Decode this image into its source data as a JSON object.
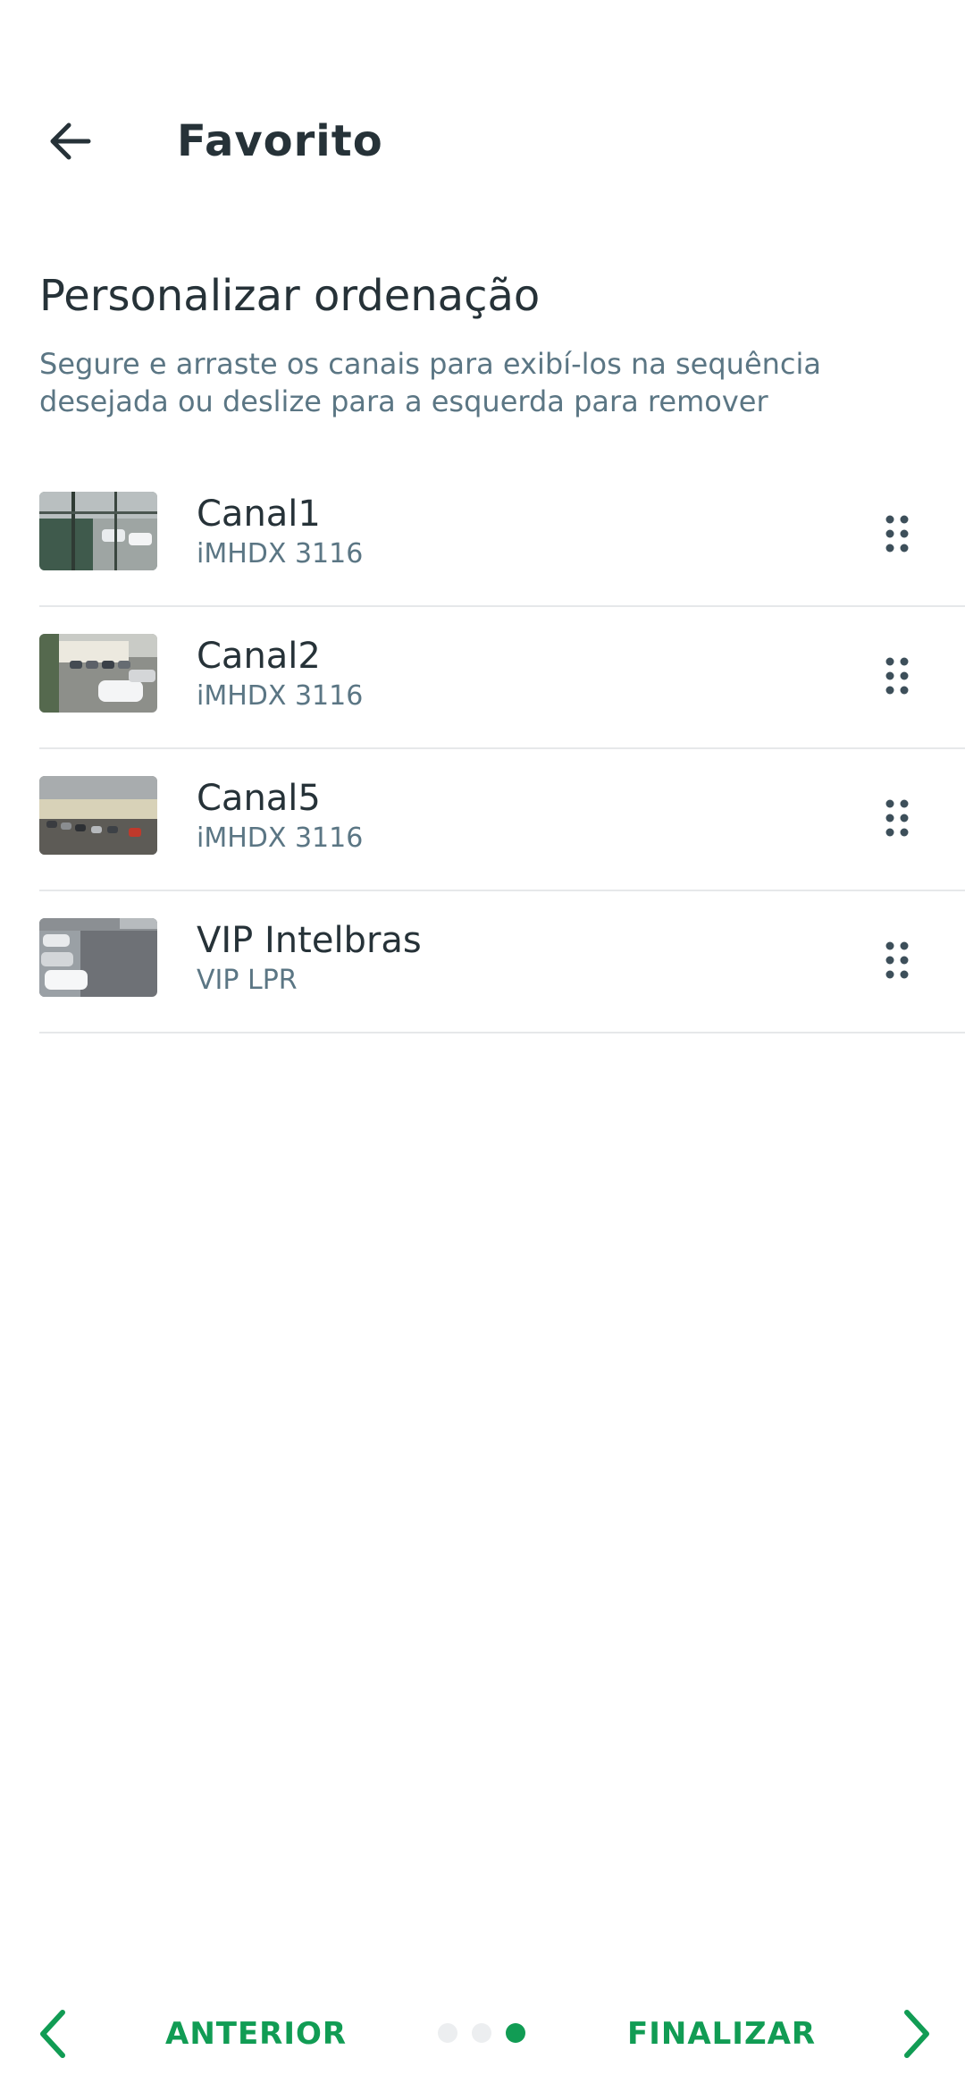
{
  "header": {
    "title": "Favorito",
    "back_icon": "arrow-left-icon"
  },
  "section": {
    "title": "Personalizar ordenação",
    "description": "Segure e arraste os canais para exibí-los na sequência desejada ou deslize para a esquerda para remover"
  },
  "channels": [
    {
      "name": "Canal1",
      "model": "iMHDX 3116"
    },
    {
      "name": "Canal2",
      "model": "iMHDX 3116"
    },
    {
      "name": "Canal5",
      "model": "iMHDX 3116"
    },
    {
      "name": "VIP Intelbras",
      "model": "VIP LPR"
    }
  ],
  "footer": {
    "prev_label": "ANTERIOR",
    "next_label": "FINALIZAR",
    "page_count": 3,
    "active_page": 3
  },
  "colors": {
    "accent": "#119c54",
    "text": "#263238",
    "muted": "#5b7684",
    "divider": "#e6e8ea"
  }
}
